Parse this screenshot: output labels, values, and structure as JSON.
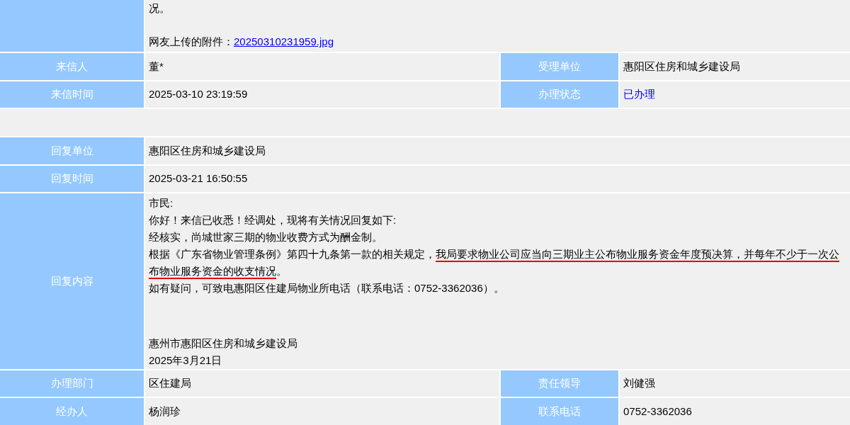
{
  "letter": {
    "lines": [
      "况。"
    ],
    "attachment_label": "网友上传的附件：",
    "attachment_link": "20250310231959.jpg"
  },
  "info_rows": [
    {
      "fields": [
        {
          "label": "来信人",
          "value": "董*"
        },
        {
          "label": "受理单位",
          "value": "惠阳区住房和城乡建设局"
        }
      ]
    },
    {
      "fields": [
        {
          "label": "来信时间",
          "value": "2025-03-10 23:19:59"
        },
        {
          "label": "办理状态",
          "value": "已办理",
          "kind": "status"
        }
      ]
    }
  ],
  "reply_rows": [
    {
      "label": "回复单位",
      "value": "惠阳区住房和城乡建设局"
    },
    {
      "label": "回复时间",
      "value": "2025-03-21 16:50:55"
    }
  ],
  "reply_content": {
    "label": "回复内容",
    "paragraphs": [
      [
        {
          "text": "市民:",
          "underlined": false
        }
      ],
      [
        {
          "text": "你好！来信已收悉！经调处，现将有关情况回复如下:",
          "underlined": false
        }
      ],
      [
        {
          "text": "经核实，尚城世家三期的物业收费方式为酬金制。",
          "underlined": false
        }
      ],
      [
        {
          "text": "根据《广东省物业管理条例》第四十九条第一款的相关规定，",
          "underlined": false
        },
        {
          "text": "我局要求物业公司应当向三期业主公布物业服务资金年度预决算，并每年不少于一次公布物业服务资金的收支情况",
          "underlined": true
        },
        {
          "text": "。",
          "underlined": false
        }
      ],
      [
        {
          "text": "如有疑问，可致电惠阳区住建局物业所电话（联系电话：0752-3362036）。",
          "underlined": false
        }
      ]
    ],
    "signature": [
      "惠州市惠阳区住房和城乡建设局",
      "2025年3月21日"
    ]
  },
  "footer_rows": [
    {
      "fields": [
        {
          "label": "办理部门",
          "value": "区住建局"
        },
        {
          "label": "责任领导",
          "value": "刘健强"
        }
      ]
    },
    {
      "fields": [
        {
          "label": "经办人",
          "value": "杨润珍"
        },
        {
          "label": "联系电话",
          "value": "0752-3362036"
        }
      ]
    }
  ]
}
